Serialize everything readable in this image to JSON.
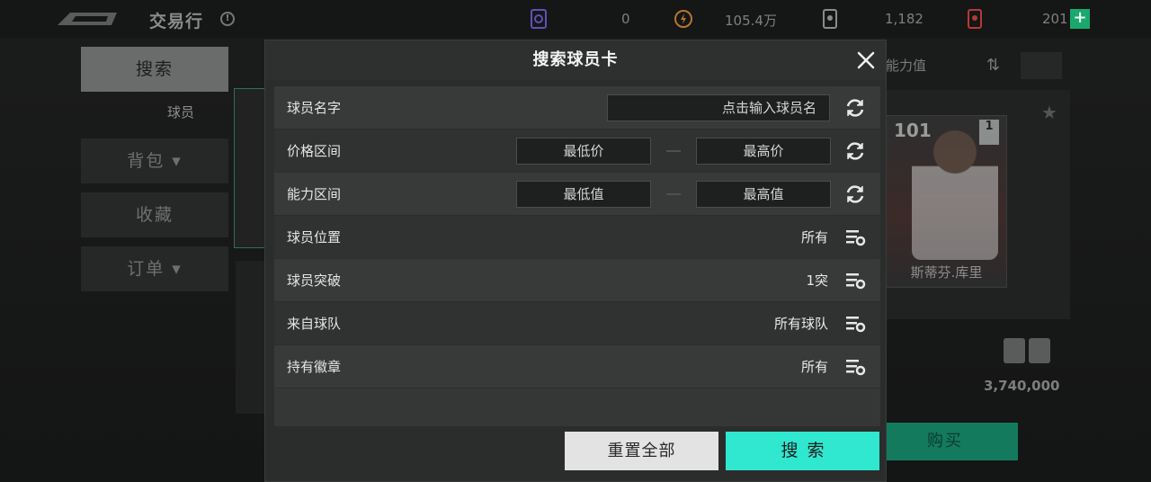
{
  "header": {
    "title": "交易行",
    "currencies": [
      {
        "icon": "ticket-icon",
        "value": "0"
      },
      {
        "icon": "coin-icon",
        "value": "105.4万"
      },
      {
        "icon": "card-token-icon",
        "value": "1,182"
      },
      {
        "icon": "red-token-icon",
        "value": "201"
      }
    ],
    "add_label": "+"
  },
  "sidebar": {
    "items": [
      {
        "label": "搜索",
        "active": true
      },
      {
        "label": "球员"
      },
      {
        "label": "背包 ▾"
      },
      {
        "label": "收藏"
      },
      {
        "label": "订单 ▾"
      }
    ]
  },
  "background": {
    "ability_label": "能力值",
    "card_rating": "101",
    "card_level": "1",
    "player_name": "斯蒂芬.库里",
    "price": "3,740,000",
    "buy_label": "购买"
  },
  "modal": {
    "title": "搜索球员卡",
    "rows": [
      {
        "label": "球员名字",
        "placeholder": "点击输入球员名"
      },
      {
        "label": "价格区间",
        "low_placeholder": "最低价",
        "high_placeholder": "最高价"
      },
      {
        "label": "能力区间",
        "low_placeholder": "最低值",
        "high_placeholder": "最高值"
      },
      {
        "label": "球员位置",
        "value": "所有"
      },
      {
        "label": "球员突破",
        "value": "1突"
      },
      {
        "label": "来自球队",
        "value": "所有球队"
      },
      {
        "label": "持有徽章",
        "value": "所有"
      }
    ],
    "reset_label": "重置全部",
    "search_label": "搜索"
  },
  "colors": {
    "accent": "#2fe8cf",
    "reset_bg": "#e3e3e3",
    "modal_bg": "#2b2c2c",
    "plus_green": "#1aa86c"
  }
}
